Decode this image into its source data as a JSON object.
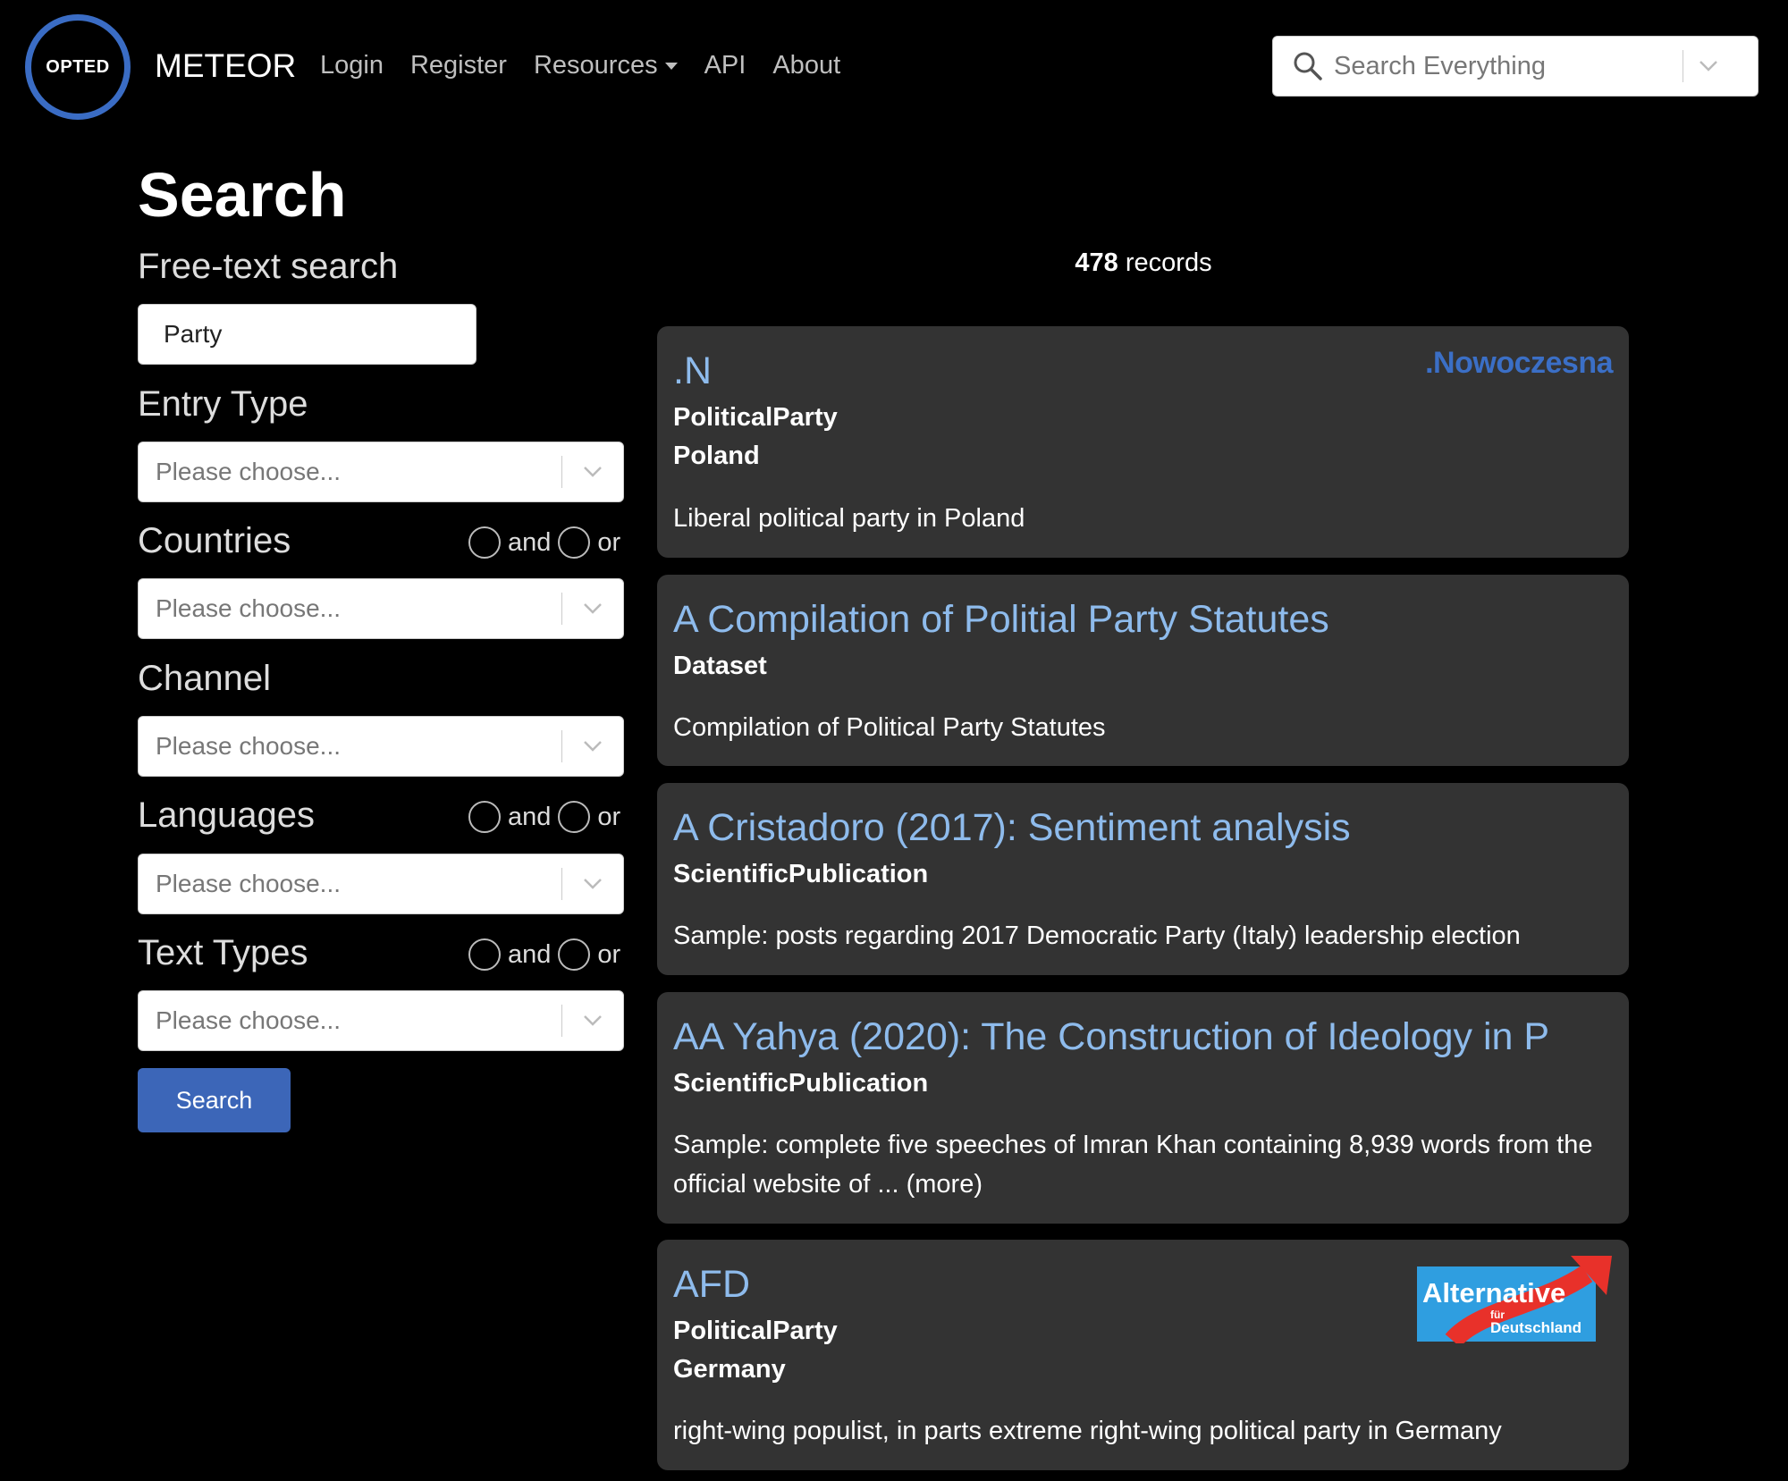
{
  "nav": {
    "logo_text": "OPTED",
    "brand": "METEOR",
    "links": [
      "Login",
      "Register",
      "Resources",
      "API",
      "About"
    ],
    "search_placeholder": "Search Everything"
  },
  "page": {
    "title": "Search"
  },
  "filters": {
    "free_text_label": "Free-text search",
    "free_text_value": "Party",
    "entry_type_label": "Entry Type",
    "countries_label": "Countries",
    "channel_label": "Channel",
    "languages_label": "Languages",
    "text_types_label": "Text Types",
    "select_placeholder": "Please choose...",
    "and_label": "and",
    "or_label": "or",
    "search_button": "Search"
  },
  "results": {
    "count": "478",
    "count_suffix": "records",
    "items": [
      {
        "title": ".N",
        "type": "PoliticalParty",
        "country": "Poland",
        "description": "Liberal political party in Poland",
        "logo_text": ".Nowoczesna"
      },
      {
        "title": "A Compilation of Politial Party Statutes",
        "type": "Dataset",
        "description": "Compilation of Political Party Statutes"
      },
      {
        "title": "A Cristadoro (2017): Sentiment analysis",
        "type": "ScientificPublication",
        "description": "Sample: posts regarding 2017 Democratic Party (Italy) leadership election"
      },
      {
        "title": "AA Yahya (2020): The Construction of Ideology in P",
        "type": "ScientificPublication",
        "description": "Sample: complete five speeches of Imran Khan containing 8,939 words from the official website of ... (more)"
      },
      {
        "title": "AFD",
        "type": "PoliticalParty",
        "country": "Germany",
        "description": "right-wing populist, in parts extreme right-wing political party in Germany",
        "logo_text": "Alternative",
        "logo_subtext_1": "für",
        "logo_subtext_2": "Deutschland"
      }
    ]
  },
  "colors": {
    "accent": "#3c66b8",
    "link": "#8ebbec",
    "card_bg": "#333333"
  }
}
